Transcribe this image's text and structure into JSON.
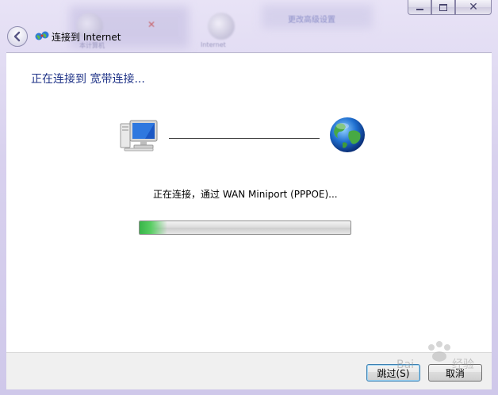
{
  "window": {
    "title": "连接到 Internet",
    "caption_buttons": {
      "minimize": "▭",
      "maximize": "▢",
      "close": "✕"
    }
  },
  "background_ghost": {
    "link_text": "更改高级设置",
    "label_right": "Internet",
    "label_left": "本计算机"
  },
  "main": {
    "heading": "正在连接到 宽带连接...",
    "status": "正在连接，通过 WAN Miniport (PPPOE)...",
    "progress_fraction": 0.13
  },
  "footer": {
    "skip_label": "跳过(S)",
    "cancel_label": "取消"
  },
  "icons": {
    "back": "back-arrow-icon",
    "title": "network-connection-icon",
    "computer": "computer-icon",
    "internet": "globe-icon"
  },
  "colors": {
    "heading": "#1e3287",
    "progress_fill": "#39b54a",
    "aero_frame": "#dcd6ee"
  }
}
